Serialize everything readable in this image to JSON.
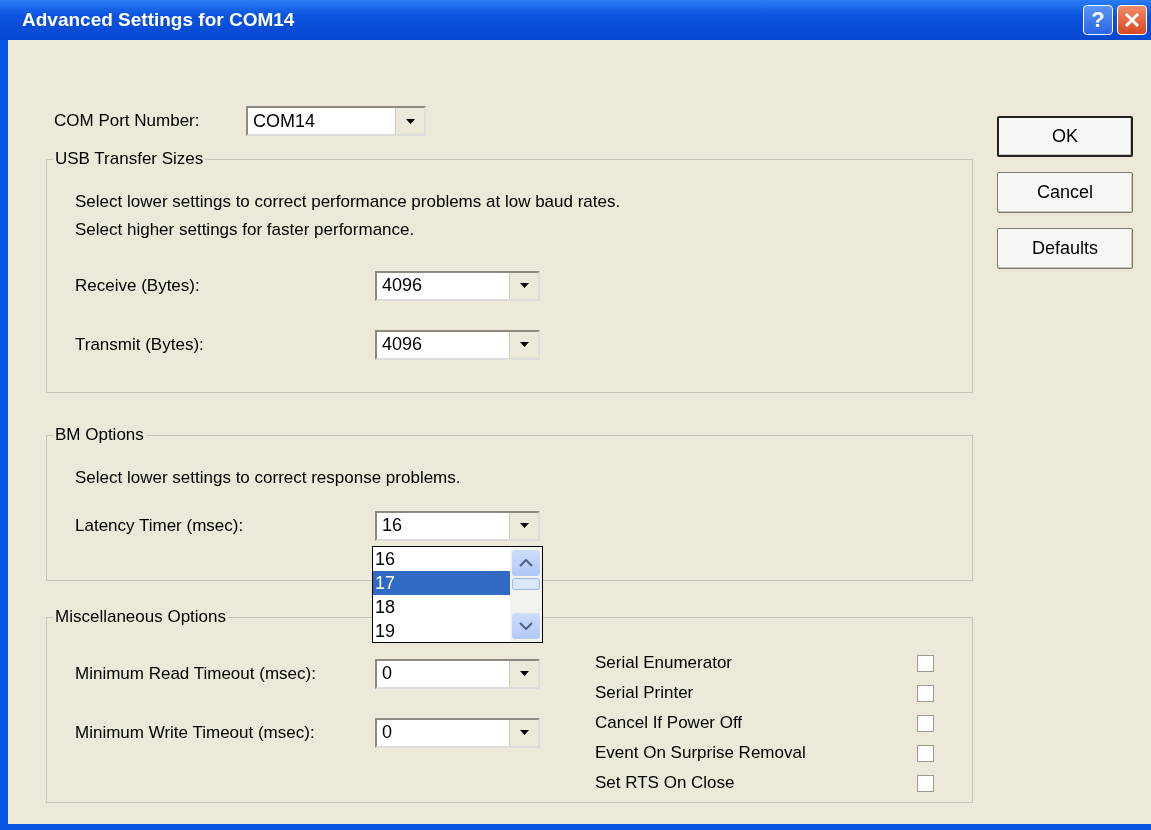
{
  "window": {
    "title": "Advanced Settings for COM14",
    "help_button": "?"
  },
  "com_port": {
    "label": "COM Port Number:",
    "value": "COM14"
  },
  "buttons": [
    {
      "label": "OK",
      "default": true
    },
    {
      "label": "Cancel",
      "default": false
    },
    {
      "label": "Defaults",
      "default": false
    }
  ],
  "usb_transfer_sizes": {
    "title": "USB Transfer Sizes",
    "notes": [
      "Select lower settings to correct performance problems at low baud rates.",
      "Select higher settings for faster performance."
    ],
    "fields": [
      {
        "label": "Receive (Bytes):",
        "value": "4096"
      },
      {
        "label": "Transmit (Bytes):",
        "value": "4096"
      }
    ]
  },
  "bm_options": {
    "title": "BM Options",
    "notes": [
      "Select lower settings to correct response problems."
    ],
    "fields": [
      {
        "label": "Latency Timer (msec):",
        "value": "16",
        "dropdown": [
          {
            "text": "16",
            "highlighted": false
          },
          {
            "text": "17",
            "highlighted": true
          },
          {
            "text": "18",
            "highlighted": false
          },
          {
            "text": "19",
            "highlighted": false
          }
        ]
      }
    ]
  },
  "misc_options": {
    "title": "Miscellaneous Options",
    "fields": [
      {
        "label": "Minimum Read Timeout (msec):",
        "value": "0"
      },
      {
        "label": "Minimum Write Timeout (msec):",
        "value": "0"
      }
    ],
    "checkboxes": [
      {
        "label": "Serial Enumerator",
        "checked": false
      },
      {
        "label": "Serial Printer",
        "checked": false
      },
      {
        "label": "Cancel If Power Off",
        "checked": false
      },
      {
        "label": "Event On Surprise Removal",
        "checked": false
      },
      {
        "label": "Set RTS On Close",
        "checked": false
      }
    ]
  }
}
